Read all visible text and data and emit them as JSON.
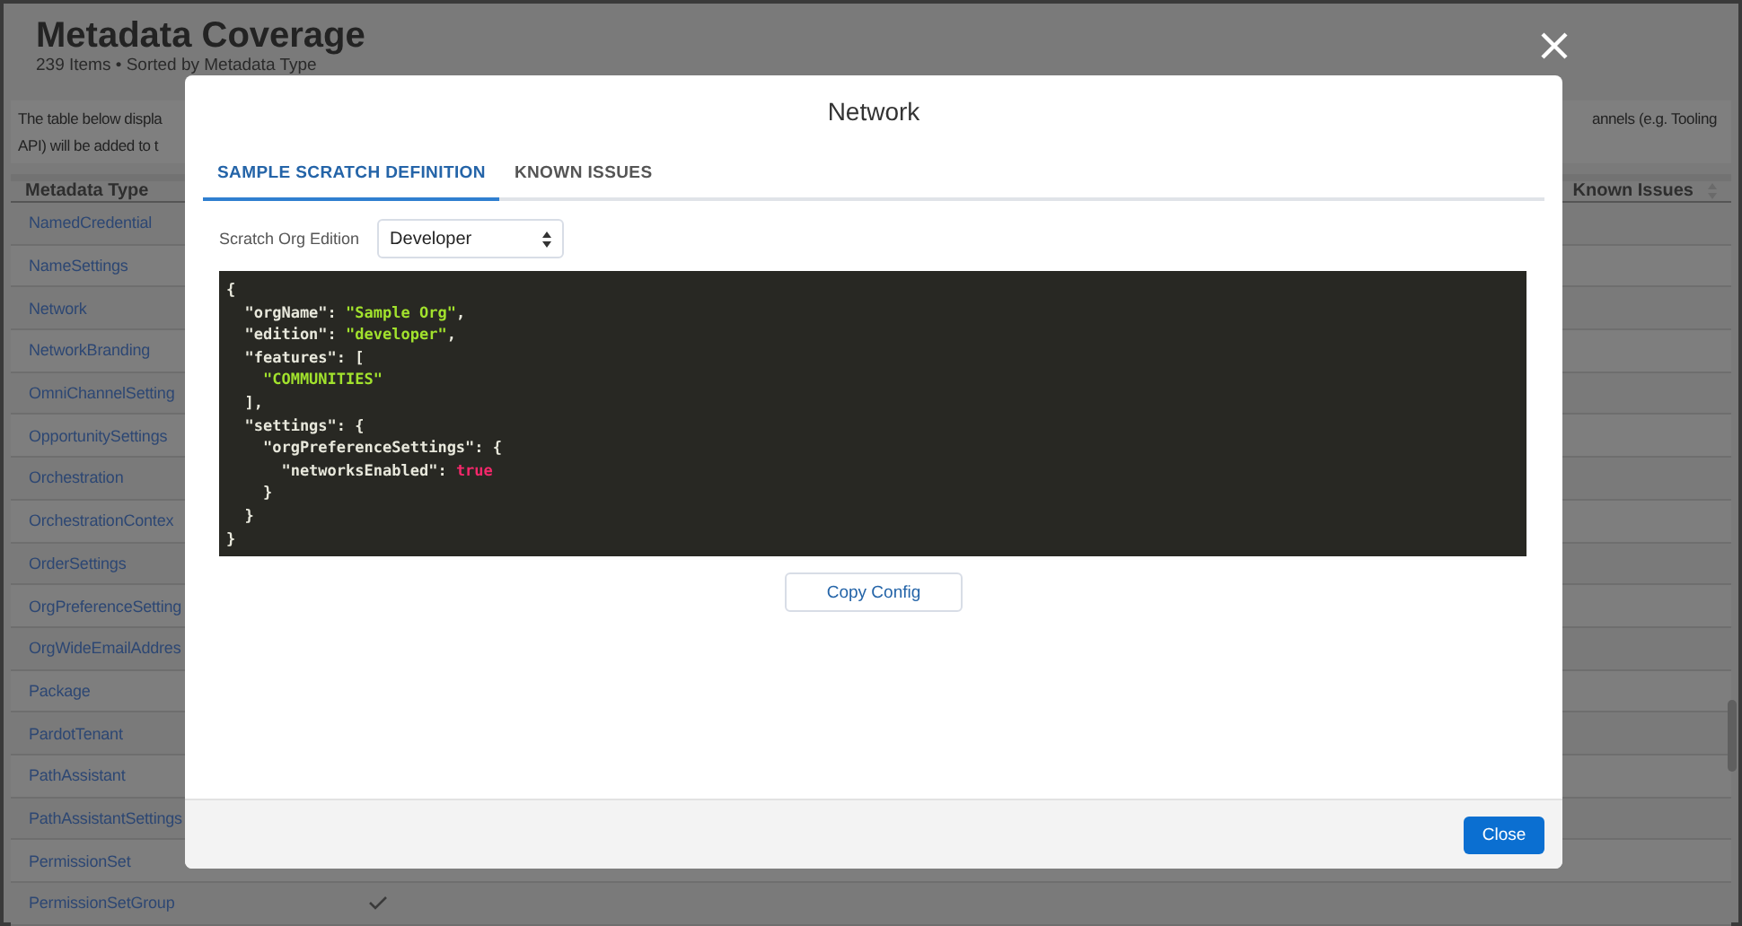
{
  "page": {
    "title": "Metadata Coverage",
    "subtitle": "239 Items • Sorted by Metadata Type",
    "description_left": [
      "The table below displa",
      "API) will be added to t"
    ],
    "description_right": "annels (e.g. Tooling"
  },
  "table": {
    "columns": [
      "Metadata Type",
      "Known Issues"
    ],
    "rows": [
      {
        "name": "NamedCredential"
      },
      {
        "name": "NameSettings"
      },
      {
        "name": "Network"
      },
      {
        "name": "NetworkBranding"
      },
      {
        "name": "OmniChannelSetting"
      },
      {
        "name": "OpportunitySettings"
      },
      {
        "name": "Orchestration"
      },
      {
        "name": "OrchestrationContex"
      },
      {
        "name": "OrderSettings"
      },
      {
        "name": "OrgPreferenceSetting"
      },
      {
        "name": "OrgWideEmailAddres"
      },
      {
        "name": "Package"
      },
      {
        "name": "PardotTenant"
      },
      {
        "name": "PathAssistant"
      },
      {
        "name": "PathAssistantSettings"
      },
      {
        "name": "PermissionSet"
      },
      {
        "name": "PermissionSetGroup",
        "checked": true
      }
    ]
  },
  "modal": {
    "title": "Network",
    "tabs": [
      {
        "label": "SAMPLE SCRATCH DEFINITION",
        "selected": true
      },
      {
        "label": "KNOWN ISSUES",
        "selected": false
      }
    ],
    "edition_label": "Scratch Org Edition",
    "edition_value": "Developer",
    "code": [
      [
        {
          "kind": "punct",
          "text": "{"
        }
      ],
      [
        {
          "kind": "key",
          "text": "  \"orgName\": "
        },
        {
          "kind": "string",
          "text": "\"Sample Org\""
        },
        {
          "kind": "punct",
          "text": ","
        }
      ],
      [
        {
          "kind": "key",
          "text": "  \"edition\": "
        },
        {
          "kind": "string",
          "text": "\"developer\""
        },
        {
          "kind": "punct",
          "text": ","
        }
      ],
      [
        {
          "kind": "key",
          "text": "  \"features\": ["
        }
      ],
      [
        {
          "kind": "string",
          "text": "    \"COMMUNITIES\""
        }
      ],
      [
        {
          "kind": "punct",
          "text": "  ],"
        }
      ],
      [
        {
          "kind": "key",
          "text": "  \"settings\": {"
        }
      ],
      [
        {
          "kind": "key",
          "text": "    \"orgPreferenceSettings\": {"
        }
      ],
      [
        {
          "kind": "key",
          "text": "      \"networksEnabled\": "
        },
        {
          "kind": "bool",
          "text": "true"
        }
      ],
      [
        {
          "kind": "punct",
          "text": "    }"
        }
      ],
      [
        {
          "kind": "punct",
          "text": "  }"
        }
      ],
      [
        {
          "kind": "punct",
          "text": "}"
        }
      ]
    ],
    "copy_button": "Copy Config",
    "close_button": "Close"
  }
}
